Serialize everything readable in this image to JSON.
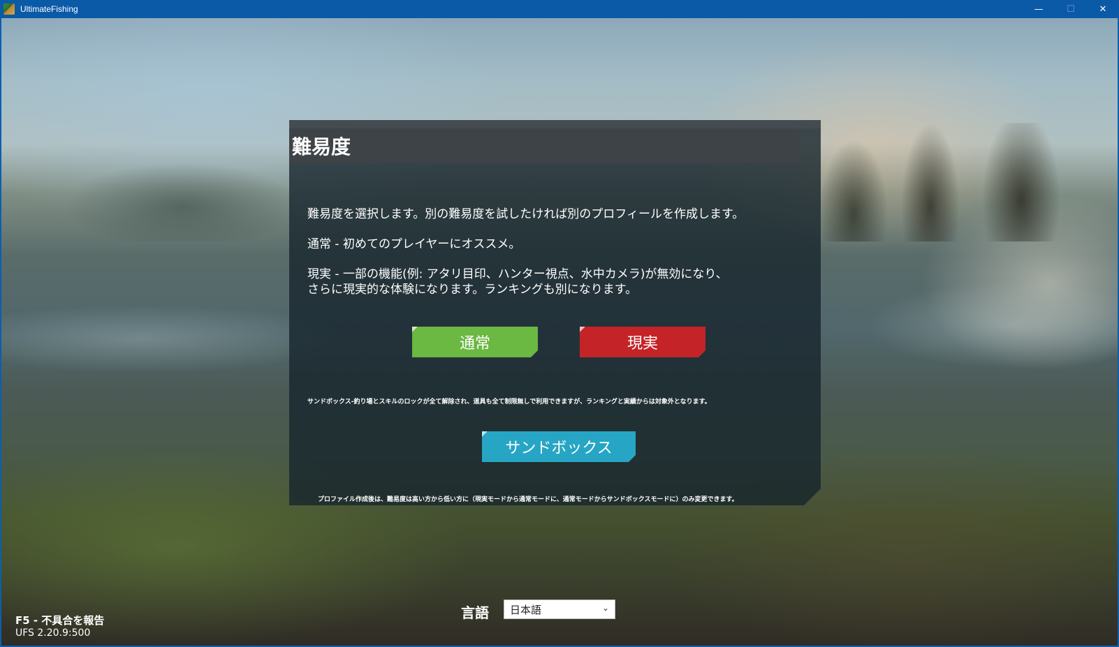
{
  "window": {
    "title": "UltimateFishing",
    "minimize": "—",
    "maximize": "☐",
    "close": "✕"
  },
  "dialog": {
    "title": "難易度",
    "intro": "難易度を選択します。別の難易度を試したければ別のプロフィールを作成します。",
    "normal_desc": "通常 - 初めてのプレイヤーにオススメ。",
    "real_desc": "現実 - 一部の機能(例: アタリ目印、ハンター視点、水中カメラ)が無効になり、\nさらに現実的な体験になります。ランキングも別になります。",
    "normal_button": "通常",
    "real_button": "現実",
    "sandbox_desc": "サンドボックス-釣り場とスキルのロックが全て解除され、道具も全て制限無しで利用できますが、ランキングと実績からは対象外となります。",
    "sandbox_button": "サンドボックス",
    "footer_note": "プロファイル作成後は、難易度は高い方から低い方に（現実モードから通常モードに、通常モードからサンドボックスモードに）のみ変更できます。"
  },
  "language": {
    "label": "言語",
    "selected": "日本語"
  },
  "footer": {
    "report": "F5 - 不具合を報告",
    "version": "UFS 2.20.9:500"
  },
  "colors": {
    "normal": "#6bb843",
    "real": "#c42427",
    "sandbox": "#26a6c4",
    "titlebar": "#0b5aa8"
  },
  "icons": {
    "app": "ultimate-fishing-app-icon",
    "dropdown": "chevron-down-icon"
  }
}
